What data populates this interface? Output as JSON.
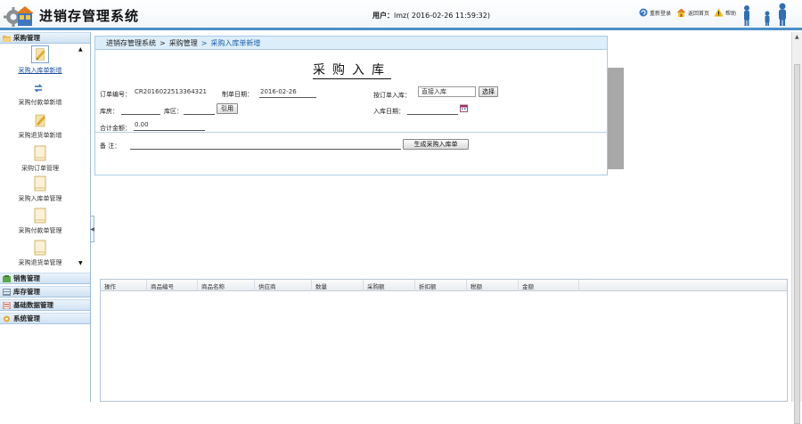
{
  "header": {
    "title": "进销存管理系统",
    "user_label": "用户：",
    "user_value": "lmz( 2016-02-26 11:59:32)",
    "links": [
      {
        "label": "重新登录",
        "icon": "refresh-icon"
      },
      {
        "label": "返回首页",
        "icon": "home-icon"
      },
      {
        "label": "帮助",
        "icon": "warning-icon"
      }
    ]
  },
  "sidebar": {
    "purchase": "采购管理",
    "items": [
      {
        "label": "采购入库单新增",
        "icon": "pencil-paper-icon",
        "active": true
      },
      {
        "label": "采购付款单新增",
        "icon": "pencil-paper-icon"
      },
      {
        "label": "采购退货单新增",
        "icon": "pencil-paper-icon"
      },
      {
        "label": "采购订单管理",
        "icon": "document-icon"
      },
      {
        "label": "采购入库单管理",
        "icon": "document-icon"
      },
      {
        "label": "采购付款单管理",
        "icon": "document-icon"
      },
      {
        "label": "采购退货单管理",
        "icon": "document-icon"
      }
    ],
    "sales": "销售管理",
    "stock": "库存管理",
    "base": "基础数据管理",
    "system": "系统管理"
  },
  "breadcrumb": {
    "root": "进销存管理系统",
    "sep": ">",
    "level1": "采购管理",
    "current": "采购入库单新增"
  },
  "form": {
    "title": "采购入库",
    "order_no_label": "订单编号：",
    "order_no": "CR2016022513364321",
    "make_date_label": "制单日期：",
    "make_date": "2016-02-26",
    "by_order_label": "按订单入库：",
    "by_order_value": "直接入库",
    "select_button": "选择",
    "warehouse_label": "库房：",
    "warehouse_value": "",
    "area_label": "库区：",
    "area_value": "",
    "reference_button": "引用",
    "in_date_label": "入库日期：",
    "in_date_value": "",
    "total_label": "合计金额：",
    "total_value": "0.00",
    "remark_label": "备  注：",
    "remark_value": "",
    "generate_button": "生成采购入库单"
  },
  "grid": {
    "columns": [
      "操作",
      "商品编号",
      "商品名称",
      "供应商",
      "数量",
      "采购额",
      "折扣额",
      "税额",
      "金额"
    ]
  }
}
